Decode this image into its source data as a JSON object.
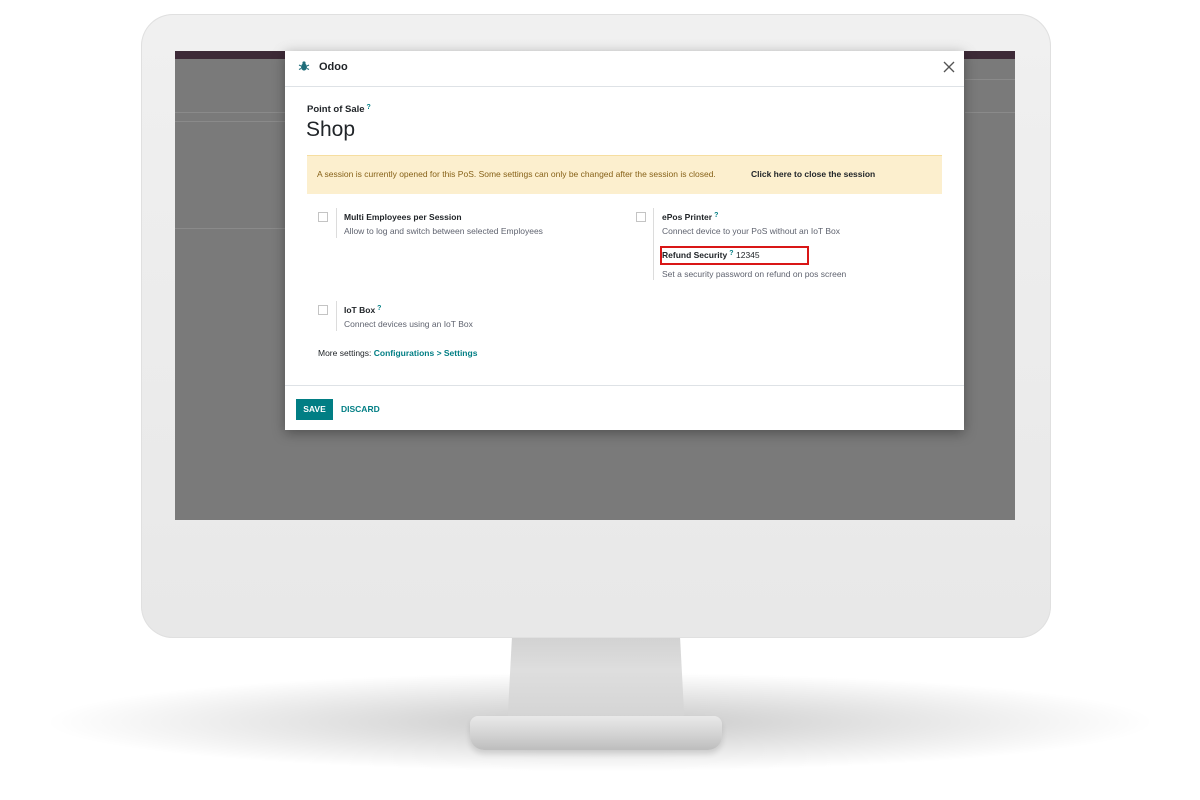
{
  "dialog": {
    "title": "Odoo",
    "close_icon": "close-icon",
    "brand_icon": "odoo-bug-icon",
    "app_label": "Point of Sale",
    "help_mark": "?",
    "record_name": "Shop"
  },
  "alert": {
    "text": "A session is currently opened for this PoS. Some settings can only be changed after the session is closed.",
    "link": "Click here to close the session"
  },
  "settings": {
    "multi_employees": {
      "title": "Multi Employees per Session",
      "description": "Allow to log and switch between selected Employees",
      "checked": false
    },
    "epos_printer": {
      "title": "ePos Printer",
      "description": "Connect device to your PoS without an IoT Box",
      "checked": false
    },
    "refund_security": {
      "label": "Refund Security",
      "value": "12345",
      "description": "Set a security password on refund on pos screen"
    },
    "iot_box": {
      "title": "IoT Box",
      "description": "Connect devices using an IoT Box",
      "checked": false
    }
  },
  "more_settings": {
    "prefix": "More settings:",
    "link": "Configurations > Settings"
  },
  "footer": {
    "save_label": "SAVE",
    "discard_label": "DISCARD"
  },
  "colors": {
    "accent": "#017e84",
    "alert_bg": "#fcefce",
    "alert_text": "#876219",
    "highlight": "#d91616",
    "app_bar": "#3d2a37"
  }
}
